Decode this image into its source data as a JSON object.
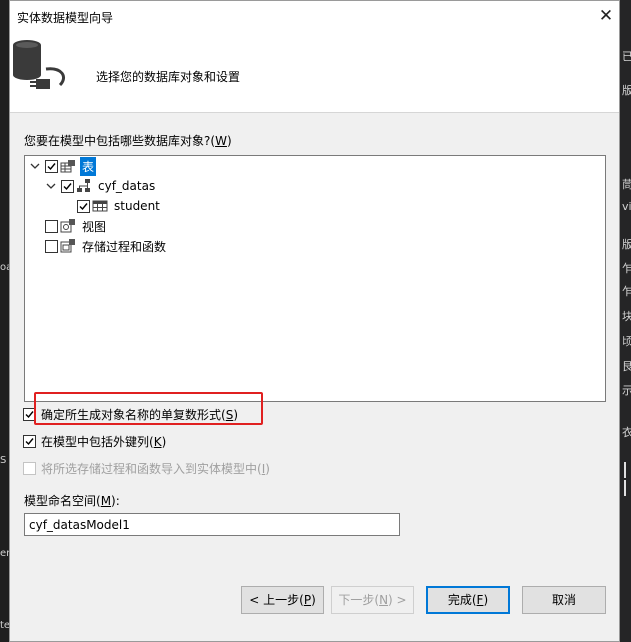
{
  "window": {
    "title": "实体数据模型向导",
    "close_glyph": "✕"
  },
  "header": {
    "text": "选择您的数据库对象和设置"
  },
  "objects": {
    "question": "您要在模型中包括哪些数据库对象?(",
    "question_key": "W",
    "question_end": ")"
  },
  "tree": {
    "tables": {
      "label": "表",
      "checked": true,
      "expanded": true
    },
    "schema": {
      "label": "cyf_datas",
      "checked": true,
      "expanded": true
    },
    "table_student": {
      "label": "student",
      "checked": true
    },
    "views": {
      "label": "视图",
      "checked": false
    },
    "procs": {
      "label": "存储过程和函数",
      "checked": false
    }
  },
  "options": {
    "pluralize": {
      "label": "确定所生成对象名称的单复数形式(",
      "key": "S",
      "end": ")",
      "checked": true
    },
    "foreign_keys": {
      "label": "在模型中包括外键列(",
      "key": "K",
      "end": ")",
      "checked": true
    },
    "import_procs": {
      "label": "将所选存储过程和函数导入到实体模型中(",
      "key": "I",
      "end": ")",
      "checked": false,
      "enabled": false
    }
  },
  "namespace": {
    "label": "模型命名空间(",
    "key": "M",
    "end": "):",
    "value": "cyf_datasModel1"
  },
  "buttons": {
    "back": {
      "pre": "< 上一步(",
      "key": "P",
      "end": ")"
    },
    "next": {
      "pre": "下一步(",
      "key": "N",
      "end": ") >"
    },
    "finish": {
      "pre": "完成(",
      "key": "F",
      "end": ")"
    },
    "cancel": "取消"
  },
  "background_left_chars": [
    "oa",
    "S",
    "er",
    "te"
  ],
  "background_right_chars": [
    "已",
    "版",
    "茼",
    "vi",
    "版",
    "乍",
    "乍",
    "块",
    "顷",
    "艮",
    "示",
    "衣"
  ],
  "colors": {
    "selection": "#0078d7",
    "highlight_box": "#e02020",
    "primary_border": "#0078d7"
  },
  "icons": {
    "wizard": "database-plug-icon",
    "table_group": "table-group-icon",
    "schema": "schema-icon",
    "table": "table-grid-icon",
    "view": "view-icon",
    "procedure": "stored-procedure-icon"
  }
}
